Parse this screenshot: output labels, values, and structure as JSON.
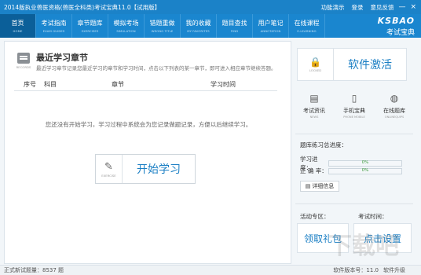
{
  "window": {
    "title": "2014版执业兽医资格(兽医全科类)考试宝典11.0【试用版】",
    "links": [
      "功能演示",
      "登录",
      "意见反馈"
    ],
    "buttons": [
      "—",
      "×"
    ]
  },
  "nav": {
    "items": [
      {
        "label": "首页",
        "sub": "HOME"
      },
      {
        "label": "考试指南",
        "sub": "EXAM GUIDES"
      },
      {
        "label": "章节题库",
        "sub": "EXERCISES"
      },
      {
        "label": "模拟考场",
        "sub": "SIMULATION"
      },
      {
        "label": "错题重做",
        "sub": "WRONG TITLE"
      },
      {
        "label": "我的收藏",
        "sub": "MY FAVORITES"
      },
      {
        "label": "题目查找",
        "sub": "FIND"
      },
      {
        "label": "用户笔记",
        "sub": "ANNOTATION"
      },
      {
        "label": "在线课程",
        "sub": "E-LEARNING"
      }
    ],
    "brand_en": "KSBAO",
    "brand_cn": "考试宝典"
  },
  "recent": {
    "icon_caption": "RECORDS",
    "title": "最近学习章节",
    "description": "最近学习章节记录您最近学习的章节和学习时间，点击以下列表的某一章节，即可进入相应章节继续答题。",
    "columns": [
      "序号",
      "科目",
      "章节",
      "学习时间"
    ],
    "empty_message": "您还没有开始学习，学习过程中系统会为您记录做题记录，方便以后继续学习。",
    "start_button": {
      "icon_caption": "EXERCISE",
      "label": "开始学习"
    }
  },
  "sidebar": {
    "activate": {
      "icon_caption": "LOCKED",
      "label": "软件激活"
    },
    "quick": [
      {
        "label": "考试资讯",
        "sub": "NEWS",
        "icon": "document-icon"
      },
      {
        "label": "手机宝典",
        "sub": "PHONE MOBILE",
        "icon": "phone-icon"
      },
      {
        "label": "在线题库",
        "sub": "ONLINEQUIPS",
        "icon": "globe-icon"
      }
    ],
    "progress_title": "题库练习总进度：",
    "progress": [
      {
        "label": "学习进度：",
        "value": "0%",
        "fraction": 0
      },
      {
        "label": "正 确 率：",
        "value": "0%",
        "fraction": 0
      }
    ],
    "detail_button": "详细信息",
    "activity_label": "活动专区：",
    "exam_time_label": "考试时间：",
    "gift_button": "领取礼包",
    "set_button": "点击设置"
  },
  "status": {
    "left": "正式新试题量：8537 题",
    "right": [
      "软件版本号：11.0",
      "软件升级"
    ]
  }
}
